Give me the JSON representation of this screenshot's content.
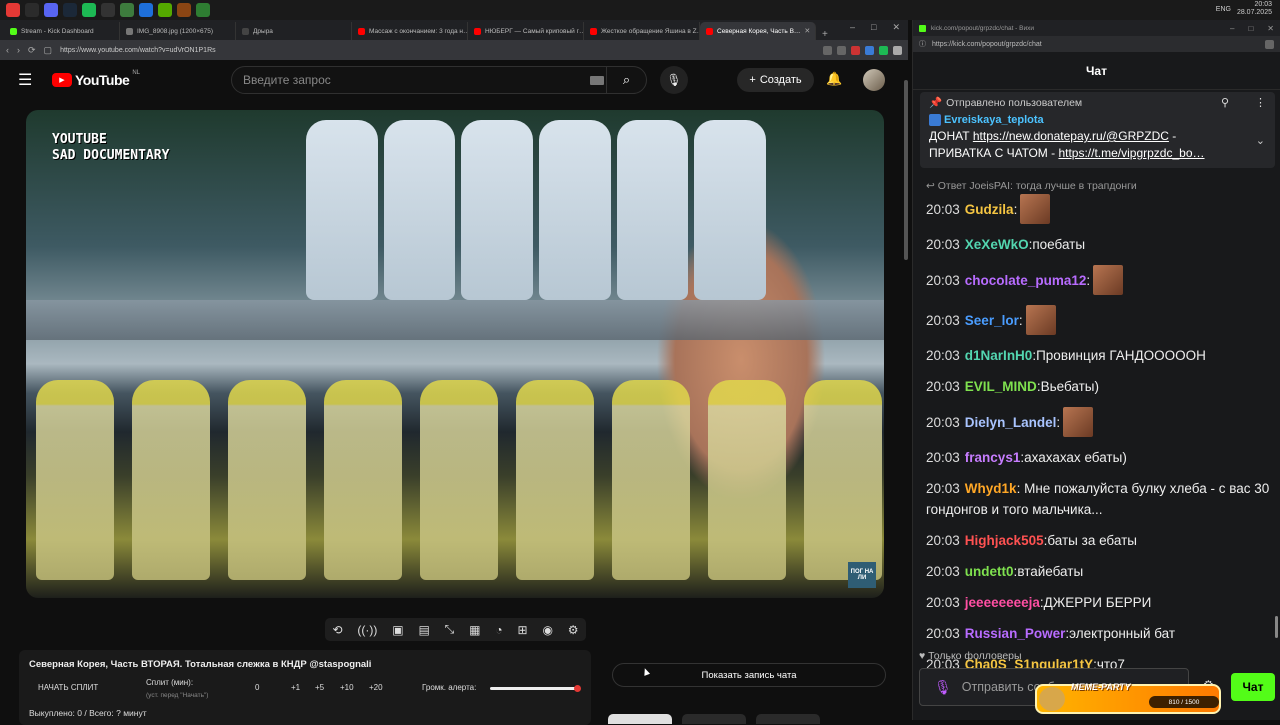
{
  "taskbar": {
    "app_colors": [
      "#e53935",
      "#2b2b2b",
      "#5865f2",
      "#1b2838",
      "#1db954",
      "#333",
      "#3d7b3d",
      "#1e6fd9",
      "#55aa00",
      "#8b4513",
      "#2e7d32"
    ],
    "clock_time": "20:03",
    "clock_date": "28.07.2025",
    "lang": "ENG"
  },
  "browser": {
    "tabs": [
      {
        "label": "Stream - Kick Dashboard",
        "color": "#53fc18"
      },
      {
        "label": "IMG_8908.jpg (1200×675)",
        "color": "#777"
      },
      {
        "label": "Дрыра",
        "color": "#444"
      },
      {
        "label": "Массаж с окончанием: 3 года н…",
        "color": "#ff0000"
      },
      {
        "label": "НЮБЕРГ — Самый криповый г…",
        "color": "#ff0000"
      },
      {
        "label": "Жесткое обращение Яшина в Z…",
        "color": "#ff0000"
      },
      {
        "label": "Северная Корея, Часть В…",
        "color": "#ff0000",
        "active": true
      }
    ],
    "url": "https://www.youtube.com/watch?v=udVrON1P1Rs"
  },
  "youtube": {
    "logo": "YouTube",
    "region": "NL",
    "search_placeholder": "Введите запрос",
    "create_label": "Создать",
    "video_overlay_line1": "YOUTUBE",
    "video_overlay_line2": "SAD DOCUMENTARY",
    "video_corner_logo": "ПОГ НА ЛИ"
  },
  "panel": {
    "title": "Северная Корея, Часть ВТОРАЯ. Тотальная слежка в КНДР @stаspognali",
    "start_split": "НАЧАТЬ СПЛИТ",
    "split_label": "Сплит (мин):",
    "split_hint": "(уст. перед \"Начать\")",
    "split_values": [
      "0",
      "+1",
      "+5",
      "+10",
      "+20"
    ],
    "alert_label": "Громк. алерта:",
    "alert_level": 1.0,
    "bought": "Выкуплено: 0 / Всего: ? минут",
    "show_chat": "Показать запись чата"
  },
  "chat": {
    "window_title": "kick.com/popout/grpzdc/chat - Вихи",
    "url": "https://kick.com/popout/grpzdc/chat",
    "header": "Чат",
    "pinned": {
      "label": "Отправлено пользователем",
      "user": "Evreiskaya_teplota",
      "message_line1_prefix": "ДОНАТ ",
      "message_line1_link": "https://new.donatepay.ru/@GRPZDC",
      "message_line1_suffix": " -",
      "message_line2_prefix": "ПРИВАТКА С ЧАТОМ - ",
      "message_line2_link": "https://t.me/vipgrpzdc_bo…"
    },
    "reply_to": "Ответ JoeisPAI: тогда лучше в трапдонги",
    "messages": [
      {
        "time": "20:03",
        "user": "Gudzila",
        "color": "#f5c542",
        "text": "",
        "emote": true
      },
      {
        "time": "20:03",
        "user": "XeXeWkO",
        "color": "#53d6b0",
        "text": "поебаты",
        "emote": false
      },
      {
        "time": "20:03",
        "user": "chocolate_puma12",
        "color": "#b86cff",
        "text": "",
        "emote": true
      },
      {
        "time": "20:03",
        "user": "Seer_lor",
        "color": "#4a9dff",
        "text": "",
        "emote": true
      },
      {
        "time": "20:03",
        "user": "d1NarInH0",
        "color": "#53d6b0",
        "text": "Провинция ГАНДОООООН",
        "emote": false
      },
      {
        "time": "20:03",
        "user": "EVIL_MIND",
        "color": "#7fe14f",
        "text": "Вьебаты)",
        "emote": false
      },
      {
        "time": "20:03",
        "user": "Dielyn_Landel",
        "color": "#a9c4ff",
        "text": "",
        "emote": true
      },
      {
        "time": "20:03",
        "user": "francys1",
        "color": "#c77dff",
        "text": "ахахахах ебаты)",
        "emote": false
      },
      {
        "time": "20:03",
        "user": "Whyd1k",
        "color": "#ffa726",
        "text": "Мне пожалуйста булку хлеба - с вас 30 гондонгов и того мальчика...",
        "emote": false
      },
      {
        "time": "20:03",
        "user": "Highjack505",
        "color": "#ff5252",
        "text": "баты за ебаты",
        "emote": false
      },
      {
        "time": "20:03",
        "user": "undett0",
        "color": "#7fe14f",
        "text": "втайебаты",
        "emote": false
      },
      {
        "time": "20:03",
        "user": "jeeeeeeeeja",
        "color": "#ff4fa3",
        "text": "ДЖЕРРИ БЕРРИ",
        "emote": false
      },
      {
        "time": "20:03",
        "user": "Russian_Power",
        "color": "#b86cff",
        "text": "электронный бат",
        "emote": false
      },
      {
        "time": "20:03",
        "user": "Cha0S_S1ngular1tY",
        "color": "#f5c542",
        "text": "что7",
        "emote": false
      }
    ],
    "followers_only": "Только фолловеры",
    "input_placeholder": "Отправить сообщение",
    "send_label": "Чат",
    "meme_party": "MEME-PARTY",
    "meme_progress": "810 / 1500"
  }
}
